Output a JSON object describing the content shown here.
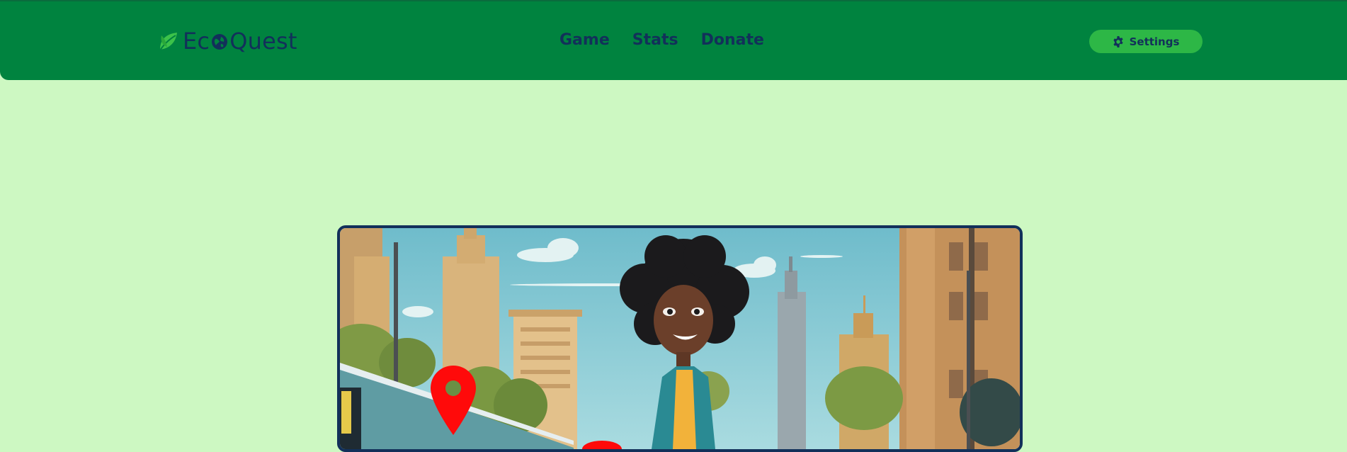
{
  "header": {
    "logo_text_before": "Ec",
    "logo_text_after": "Quest",
    "logo_icon": "leaf-icon",
    "logo_globe_icon": "globe-icon",
    "nav": [
      {
        "label": "Game"
      },
      {
        "label": "Stats"
      },
      {
        "label": "Donate"
      }
    ],
    "settings": {
      "label": "Settings",
      "icon": "gear-icon"
    }
  },
  "game": {
    "scene_image": "city-street-character-scene",
    "markers": [
      "map-pin-icon",
      "map-pin-icon"
    ]
  },
  "colors": {
    "header_bg": "#00833f",
    "page_bg": "#cdf8c2",
    "text_dark": "#12305a",
    "settings_bg": "#2db746",
    "marker_red": "#ff0000"
  }
}
